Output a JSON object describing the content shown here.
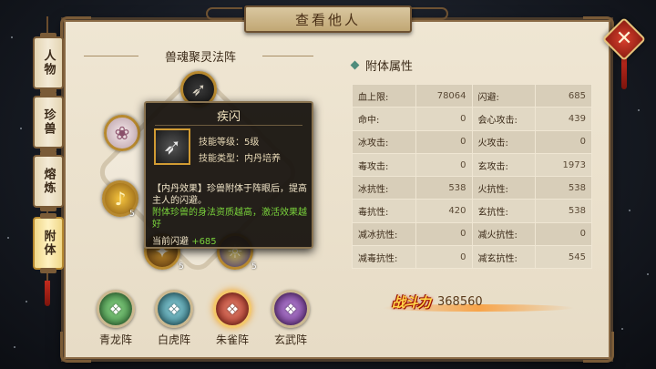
{
  "title": "查看他人",
  "close_icon": "close-icon",
  "side_tabs": [
    {
      "label": "人物",
      "active": false
    },
    {
      "label": "珍兽",
      "active": false
    },
    {
      "label": "熔炼",
      "active": false
    },
    {
      "label": "附体",
      "active": true
    }
  ],
  "left": {
    "title": "兽魂聚灵法阵",
    "slots": [
      {
        "icon": "dash-skill-icon",
        "badge": ""
      },
      {
        "icon": "cat-beast-icon",
        "badge": ""
      },
      {
        "icon": "bell-icon",
        "badge": "5"
      },
      {
        "icon": "beast-icon",
        "badge": "5"
      },
      {
        "icon": "beast-icon",
        "badge": "5"
      },
      {
        "icon": "beast-icon",
        "badge": ""
      }
    ]
  },
  "tooltip": {
    "name": "疾闪",
    "level_line": "技能等级：5级",
    "type_line": "技能类型：内丹培养",
    "desc": "【内丹效果】珍兽附体于阵眼后，提高主人的闪避。",
    "green": "附体珍兽的身法资质越高，激活效果越好",
    "current_label": "当前闪避",
    "current_value": "+685"
  },
  "formations": [
    {
      "label": "青龙阵",
      "color": "#4a9b52",
      "icon": "dragon-icon",
      "active": false
    },
    {
      "label": "白虎阵",
      "color": "#3e8c9a",
      "icon": "tiger-icon",
      "active": false
    },
    {
      "label": "朱雀阵",
      "color": "#c8412f",
      "icon": "phoenix-icon",
      "active": true
    },
    {
      "label": "玄武阵",
      "color": "#8a43b0",
      "icon": "tortoise-icon",
      "active": false
    }
  ],
  "attributes": {
    "title": "附体属性",
    "rows": [
      [
        {
          "k": "血上限:",
          "v": "78064"
        },
        {
          "k": "闪避:",
          "v": "685"
        }
      ],
      [
        {
          "k": "命中:",
          "v": "0"
        },
        {
          "k": "会心攻击:",
          "v": "439"
        }
      ],
      [
        {
          "k": "冰攻击:",
          "v": "0"
        },
        {
          "k": "火攻击:",
          "v": "0"
        }
      ],
      [
        {
          "k": "毒攻击:",
          "v": "0"
        },
        {
          "k": "玄攻击:",
          "v": "1973"
        }
      ],
      [
        {
          "k": "冰抗性:",
          "v": "538"
        },
        {
          "k": "火抗性:",
          "v": "538"
        }
      ],
      [
        {
          "k": "毒抗性:",
          "v": "420"
        },
        {
          "k": "玄抗性:",
          "v": "538"
        }
      ],
      [
        {
          "k": "减冰抗性:",
          "v": "0"
        },
        {
          "k": "减火抗性:",
          "v": "0"
        }
      ],
      [
        {
          "k": "减毒抗性:",
          "v": "0"
        },
        {
          "k": "减玄抗性:",
          "v": "545"
        }
      ]
    ]
  },
  "power": {
    "label": "战斗力",
    "value": "368560"
  }
}
